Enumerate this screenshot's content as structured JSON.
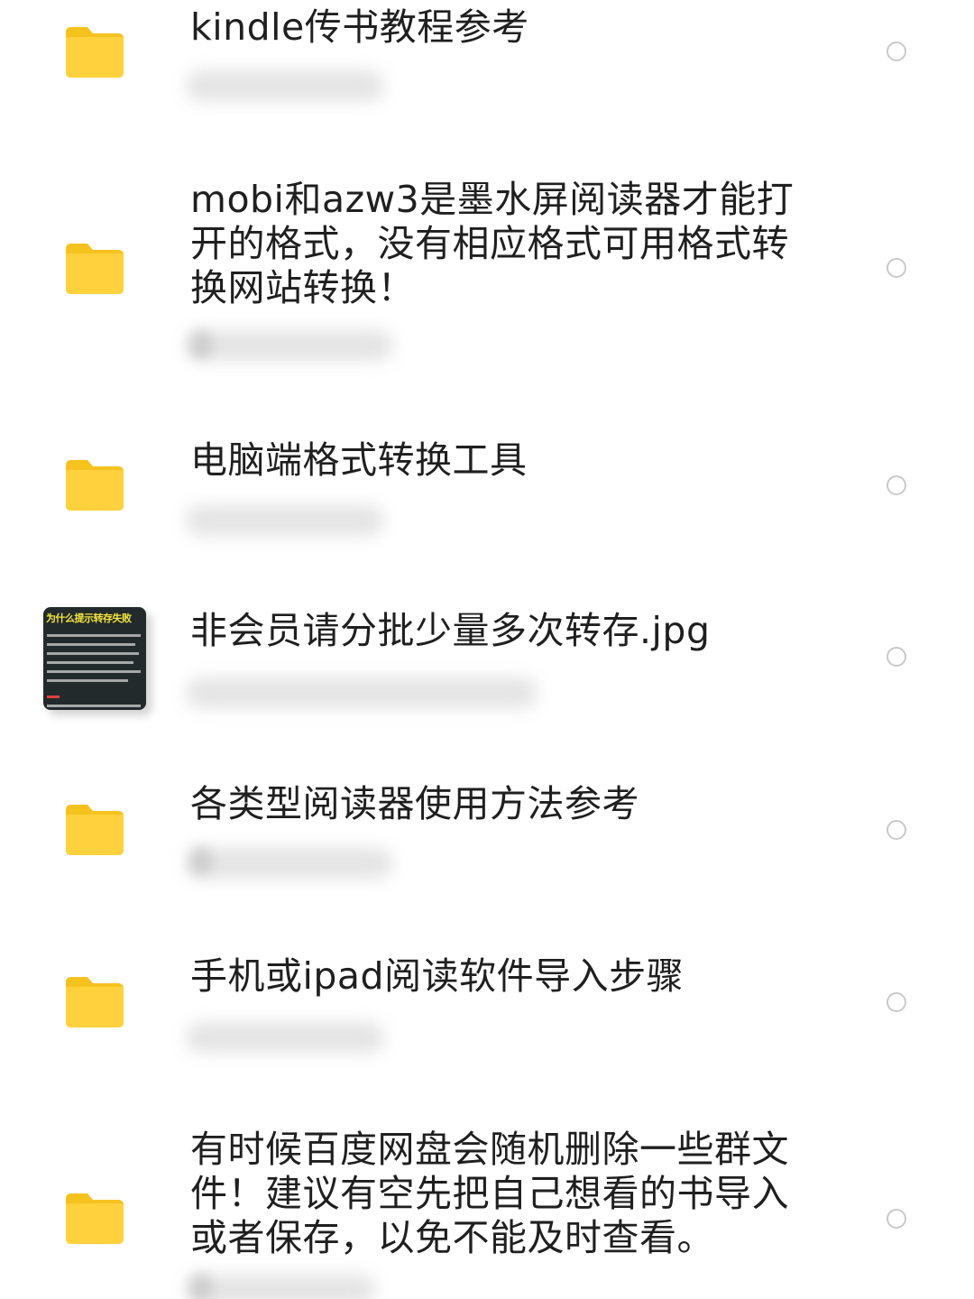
{
  "files": [
    {
      "type": "folder",
      "name": "kindle传书教程参考",
      "meta": ""
    },
    {
      "type": "folder",
      "name": "mobi和azw3是墨水屏阅读器才能打开的格式，没有相应格式可用格式转换网站转换！",
      "meta": "0"
    },
    {
      "type": "folder",
      "name": "电脑端格式转换工具",
      "meta": ""
    },
    {
      "type": "image",
      "name": "非会员请分批少量多次转存.jpg",
      "meta": "",
      "thumb_title": "为什么提示转存失败"
    },
    {
      "type": "folder",
      "name": "各类型阅读器使用方法参考",
      "meta": "0"
    },
    {
      "type": "folder",
      "name": "手机或ipad阅读软件导入步骤",
      "meta": ""
    },
    {
      "type": "folder",
      "name": "有时候百度网盘会随机删除一些群文件！建议有空先把自己想看的书导入或者保存，以免不能及时查看。",
      "meta": "0"
    }
  ],
  "colors": {
    "folder": "#FFD23D",
    "folder_tab": "#F6C21E",
    "text": "#1f1f1f",
    "radio_border": "#c9c9c9"
  },
  "icons": {
    "folder": "folder-icon",
    "image": "image-thumbnail",
    "select": "radio-circle-icon"
  }
}
